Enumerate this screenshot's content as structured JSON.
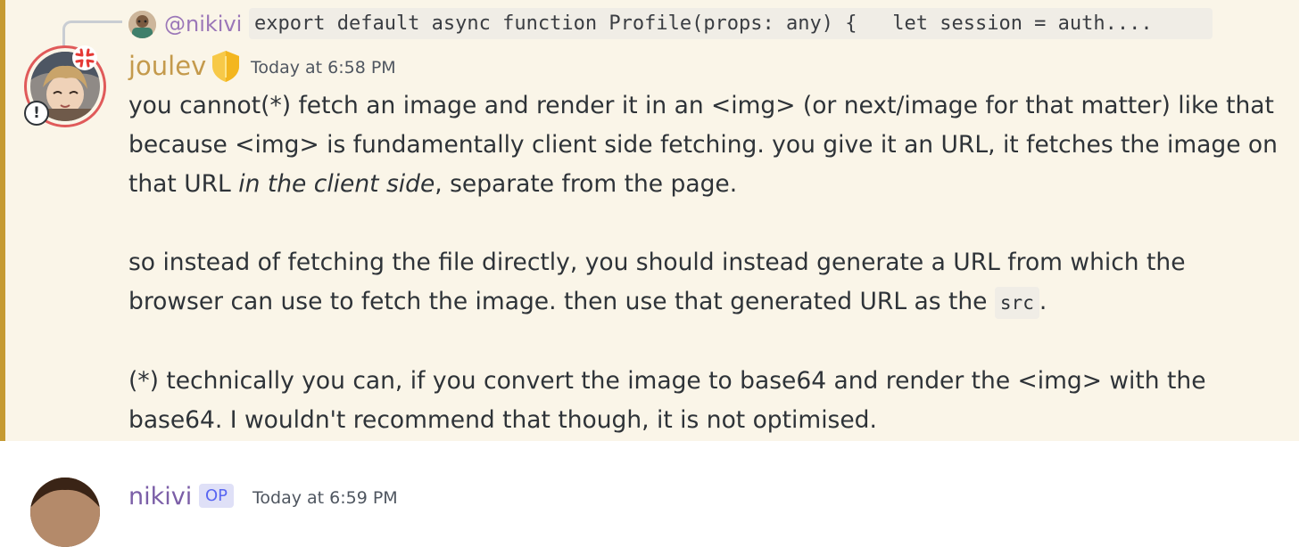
{
  "reply": {
    "username": "@nikivi",
    "code_preview": "export default async function Profile(props: any) {   let session = auth...."
  },
  "message": {
    "username": "joulev",
    "timestamp": "Today at 6:58 PM",
    "p1_part1": "you cannot(*) fetch an image and render it in an <img> (or next/image for that matter) like that because <img> is fundamentally client side fetching. you give it an URL, it fetches the image on that URL ",
    "p1_italic": "in the client side",
    "p1_part2": ", separate from the page.",
    "p2_part1": "so instead of fetching the file directly, you should instead generate a URL from which the browser can use to fetch the image. then use that generated URL as the ",
    "p2_code": "src",
    "p2_part2": ".",
    "p3": "(*) technically you can, if you convert the image to base64 and render the <img> with the base64. I wouldn't recommend that though, it is not optimised.",
    "alert_symbol": "!",
    "icons": [
      "anger-icon",
      "shield-badge-icon",
      "alert-icon"
    ]
  },
  "next_message": {
    "username": "nikivi",
    "badge": "OP",
    "timestamp": "Today at 6:59 PM"
  },
  "colors": {
    "highlight_bg": "#faf5e8",
    "mention_bar": "#c59a32",
    "joulev_name": "#c49a4c",
    "nikivi_name": "#7b5ea7",
    "op_badge": "#5865f2"
  }
}
